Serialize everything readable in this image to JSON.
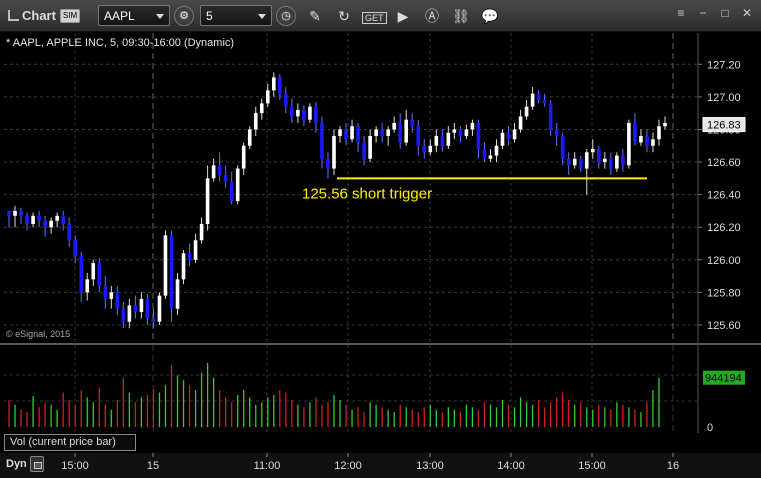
{
  "toolbar": {
    "app_title": "Chart",
    "sim_badge": "SIM",
    "symbol": "AAPL",
    "interval": "5"
  },
  "study_title": "* AAPL, APPLE INC, 5, 09:30-16:00 (Dynamic)",
  "copyright": "© eSignal, 2015",
  "vol_title": "Vol (current price bar)",
  "dyn_label": "Dyn",
  "colors": {
    "up": "#ffffff",
    "down": "#1a1aff",
    "vol_up": "#33cc33",
    "vol_down": "#cc2222",
    "trigger": "#ffee00",
    "last_price_bg": "#e8e8e8",
    "vol_last_bg": "#22aa22"
  },
  "chart_data": [
    {
      "type": "candlestick",
      "symbol": "AAPL",
      "interval_minutes": 5,
      "session": "09:30-16:00",
      "y_ticks": [
        "127.20",
        "127.00",
        "126.80",
        "126.60",
        "126.40",
        "126.20",
        "126.00",
        "125.80",
        "125.60"
      ],
      "ylim": [
        125.52,
        127.3
      ],
      "x_ticks": [
        "15:00",
        "15",
        "11:00",
        "12:00",
        "13:00",
        "14:00",
        "15:00",
        "16"
      ],
      "last_price": "126.83",
      "annotation": {
        "text": "125.56 short trigger",
        "level": 126.5
      },
      "candles": [
        [
          126.3,
          126.27,
          126.3,
          126.2
        ],
        [
          126.27,
          126.3,
          126.33,
          126.2
        ],
        [
          126.3,
          126.27,
          126.32,
          126.22
        ],
        [
          126.27,
          126.22,
          126.29,
          126.18
        ],
        [
          126.22,
          126.27,
          126.29,
          126.2
        ],
        [
          126.27,
          126.24,
          126.3,
          126.2
        ],
        [
          126.24,
          126.2,
          126.27,
          126.14
        ],
        [
          126.2,
          126.24,
          126.26,
          126.16
        ],
        [
          126.24,
          126.27,
          126.29,
          126.2
        ],
        [
          126.27,
          126.22,
          126.3,
          126.18
        ],
        [
          126.22,
          126.12,
          126.26,
          126.08
        ],
        [
          126.12,
          126.02,
          126.15,
          125.98
        ],
        [
          126.02,
          125.8,
          126.05,
          125.74
        ],
        [
          125.8,
          125.88,
          125.92,
          125.75
        ],
        [
          125.88,
          125.98,
          126.0,
          125.84
        ],
        [
          125.98,
          125.84,
          126.01,
          125.8
        ],
        [
          125.84,
          125.76,
          125.9,
          125.7
        ],
        [
          125.76,
          125.8,
          125.84,
          125.7
        ],
        [
          125.8,
          125.7,
          125.84,
          125.66
        ],
        [
          125.7,
          125.62,
          125.74,
          125.58
        ],
        [
          125.62,
          125.72,
          125.76,
          125.58
        ],
        [
          125.72,
          125.68,
          125.78,
          125.64
        ],
        [
          125.68,
          125.76,
          125.8,
          125.64
        ],
        [
          125.76,
          125.64,
          125.79,
          125.6
        ],
        [
          125.64,
          125.62,
          125.7,
          125.58
        ],
        [
          125.62,
          125.78,
          125.8,
          125.6
        ],
        [
          125.78,
          126.15,
          126.18,
          125.76
        ],
        [
          126.15,
          125.7,
          126.18,
          125.62
        ],
        [
          125.7,
          125.88,
          125.92,
          125.66
        ],
        [
          125.88,
          126.04,
          126.06,
          125.85
        ],
        [
          126.04,
          126.0,
          126.1,
          125.96
        ],
        [
          126.0,
          126.12,
          126.16,
          125.98
        ],
        [
          126.12,
          126.22,
          126.26,
          126.1
        ],
        [
          126.22,
          126.5,
          126.58,
          126.18
        ],
        [
          126.5,
          126.58,
          126.62,
          126.48
        ],
        [
          126.58,
          126.52,
          126.66,
          126.48
        ],
        [
          126.52,
          126.48,
          126.58,
          126.44
        ],
        [
          126.48,
          126.36,
          126.54,
          126.34
        ],
        [
          126.36,
          126.56,
          126.58,
          126.34
        ],
        [
          126.56,
          126.7,
          126.72,
          126.52
        ],
        [
          126.7,
          126.8,
          126.82,
          126.68
        ],
        [
          126.8,
          126.9,
          126.94,
          126.76
        ],
        [
          126.9,
          126.96,
          126.99,
          126.86
        ],
        [
          126.96,
          127.04,
          127.08,
          126.94
        ],
        [
          127.04,
          127.12,
          127.15,
          127.0
        ],
        [
          127.12,
          127.02,
          127.14,
          126.98
        ],
        [
          127.02,
          126.94,
          127.06,
          126.9
        ],
        [
          126.94,
          126.88,
          126.99,
          126.84
        ],
        [
          126.88,
          126.92,
          126.96,
          126.84
        ],
        [
          126.92,
          126.86,
          126.95,
          126.82
        ],
        [
          126.86,
          126.94,
          126.96,
          126.84
        ],
        [
          126.94,
          126.84,
          126.97,
          126.78
        ],
        [
          126.84,
          126.62,
          126.88,
          126.56
        ],
        [
          126.62,
          126.56,
          126.66,
          126.5
        ],
        [
          126.56,
          126.76,
          126.8,
          126.52
        ],
        [
          126.76,
          126.8,
          126.82,
          126.72
        ],
        [
          126.8,
          126.74,
          126.84,
          126.7
        ],
        [
          126.74,
          126.82,
          126.86,
          126.72
        ],
        [
          126.82,
          126.72,
          126.84,
          126.66
        ],
        [
          126.72,
          126.62,
          126.76,
          126.58
        ],
        [
          126.62,
          126.76,
          126.8,
          126.6
        ],
        [
          126.76,
          126.8,
          126.82,
          126.72
        ],
        [
          126.8,
          126.76,
          126.84,
          126.72
        ],
        [
          126.76,
          126.8,
          126.82,
          126.7
        ],
        [
          126.8,
          126.84,
          126.88,
          126.78
        ],
        [
          126.84,
          126.72,
          126.9,
          126.68
        ],
        [
          126.72,
          126.86,
          126.92,
          126.7
        ],
        [
          126.86,
          126.82,
          126.9,
          126.78
        ],
        [
          126.82,
          126.7,
          126.86,
          126.64
        ],
        [
          126.7,
          126.66,
          126.74,
          126.62
        ],
        [
          126.66,
          126.7,
          126.74,
          126.64
        ],
        [
          126.7,
          126.76,
          126.8,
          126.66
        ],
        [
          126.76,
          126.7,
          126.8,
          126.66
        ],
        [
          126.7,
          126.78,
          126.82,
          126.68
        ],
        [
          126.78,
          126.8,
          126.84,
          126.74
        ],
        [
          126.8,
          126.76,
          126.82,
          126.72
        ],
        [
          126.76,
          126.8,
          126.83,
          126.74
        ],
        [
          126.8,
          126.84,
          126.86,
          126.76
        ],
        [
          126.84,
          126.68,
          126.86,
          126.62
        ],
        [
          126.68,
          126.62,
          126.72,
          126.6
        ],
        [
          126.62,
          126.64,
          126.68,
          126.6
        ],
        [
          126.64,
          126.7,
          126.74,
          126.6
        ],
        [
          126.7,
          126.78,
          126.8,
          126.68
        ],
        [
          126.78,
          126.74,
          126.82,
          126.7
        ],
        [
          126.74,
          126.8,
          126.84,
          126.72
        ],
        [
          126.8,
          126.88,
          126.92,
          126.78
        ],
        [
          126.88,
          126.94,
          126.98,
          126.86
        ],
        [
          126.94,
          127.02,
          127.06,
          126.92
        ],
        [
          127.02,
          126.98,
          127.04,
          126.96
        ],
        [
          126.98,
          126.96,
          127.02,
          126.94
        ],
        [
          126.96,
          126.8,
          126.98,
          126.76
        ],
        [
          126.8,
          126.76,
          126.84,
          126.7
        ],
        [
          126.76,
          126.62,
          126.78,
          126.58
        ],
        [
          126.62,
          126.58,
          126.66,
          126.52
        ],
        [
          126.58,
          126.62,
          126.66,
          126.56
        ],
        [
          126.62,
          126.56,
          126.64,
          126.54
        ],
        [
          126.56,
          126.66,
          126.68,
          126.4
        ],
        [
          126.66,
          126.68,
          126.74,
          126.62
        ],
        [
          126.68,
          126.6,
          126.7,
          126.56
        ],
        [
          126.6,
          126.62,
          126.66,
          126.56
        ],
        [
          126.62,
          126.56,
          126.66,
          126.52
        ],
        [
          126.56,
          126.64,
          126.66,
          126.54
        ],
        [
          126.64,
          126.58,
          126.68,
          126.54
        ],
        [
          126.58,
          126.84,
          126.86,
          126.56
        ],
        [
          126.84,
          126.72,
          126.9,
          126.7
        ],
        [
          126.72,
          126.76,
          126.8,
          126.7
        ],
        [
          126.76,
          126.7,
          126.8,
          126.66
        ],
        [
          126.7,
          126.74,
          126.78,
          126.66
        ],
        [
          126.74,
          126.82,
          126.86,
          126.7
        ],
        [
          126.82,
          126.84,
          126.88,
          126.8
        ]
      ]
    },
    {
      "type": "bar",
      "name": "Vol (current price bar)",
      "last_value": "944194",
      "y_ticks": [
        "0"
      ],
      "values": [
        22,
        18,
        14,
        12,
        25,
        16,
        20,
        18,
        14,
        28,
        22,
        18,
        30,
        24,
        20,
        32,
        18,
        14,
        22,
        40,
        28,
        20,
        24,
        26,
        30,
        28,
        34,
        50,
        42,
        38,
        34,
        30,
        44,
        52,
        40,
        30,
        24,
        20,
        26,
        30,
        24,
        18,
        20,
        24,
        26,
        30,
        28,
        22,
        18,
        16,
        20,
        24,
        18,
        20,
        26,
        22,
        18,
        14,
        16,
        12,
        20,
        18,
        16,
        14,
        12,
        18,
        16,
        14,
        12,
        16,
        18,
        14,
        12,
        16,
        14,
        12,
        18,
        16,
        14,
        20,
        18,
        16,
        22,
        18,
        16,
        24,
        20,
        18,
        22,
        16,
        20,
        24,
        28,
        22,
        18,
        20,
        16,
        14,
        18,
        16,
        14,
        20,
        18,
        16,
        14,
        12,
        20,
        30,
        40
      ],
      "ylim": [
        0,
        60
      ]
    }
  ]
}
